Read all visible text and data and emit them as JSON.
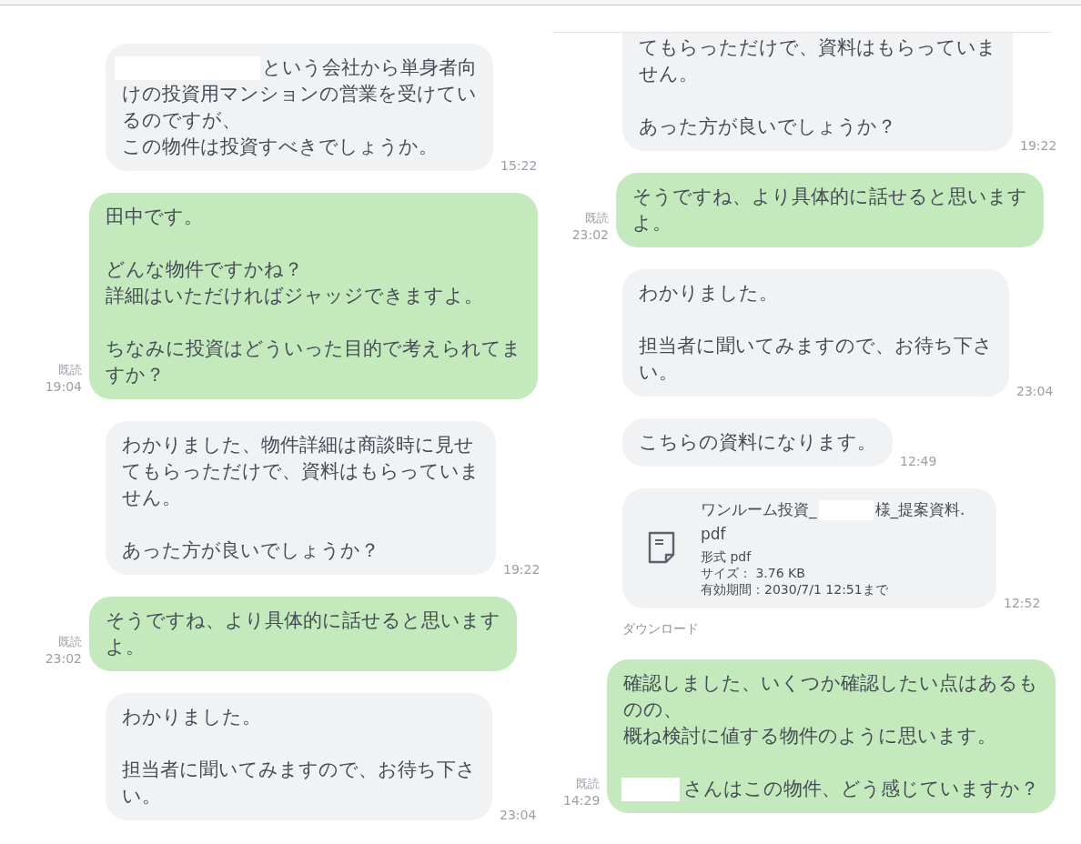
{
  "panels": [
    {
      "messages": [
        {
          "outgoing": false,
          "kind": "text",
          "paragraphs": [
            [
              [
                {
                  "kind": "redaction-long"
                },
                {
                  "kind": "text",
                  "text": "という会社から単身者向"
                }
              ],
              "けの投資用マンションの営業を受けてい",
              "るのですが、",
              "この物件は投資すべきでしょうか。"
            ]
          ],
          "time": "15:22"
        },
        {
          "outgoing": true,
          "kind": "text",
          "paragraphs": [
            [
              "田中です。"
            ],
            [
              "どんな物件ですかね？",
              "詳細はいただければジャッジできますよ。"
            ],
            [
              "ちなみに投資はどういった目的で考えられてま",
              "すか？"
            ]
          ],
          "time": "19:04",
          "read_label": "既読"
        },
        {
          "outgoing": false,
          "kind": "text",
          "paragraphs": [
            [
              "わかりました、物件詳細は商談時に見せ",
              "てもらっただけで、資料はもらっていま",
              "せん。"
            ],
            [
              "あった方が良いでしょうか？"
            ]
          ],
          "time": "19:22"
        },
        {
          "outgoing": true,
          "kind": "text",
          "paragraphs": [
            [
              "そうですね、より具体的に話せると思います",
              "よ。"
            ]
          ],
          "time": "23:02",
          "read_label": "既読"
        },
        {
          "outgoing": false,
          "kind": "text",
          "paragraphs": [
            [
              "わかりました。"
            ],
            [
              "担当者に聞いてみますので、お待ち下さ",
              "い。"
            ]
          ],
          "time": "23:04"
        }
      ]
    },
    {
      "messages": [
        {
          "outgoing": false,
          "kind": "text",
          "clipped_top": true,
          "paragraphs": [
            [
              "てもらっただけで、資料はもらっていま",
              "せん。"
            ],
            [
              "あった方が良いでしょうか？"
            ]
          ],
          "time": "19:22"
        },
        {
          "outgoing": true,
          "kind": "text",
          "paragraphs": [
            [
              "そうですね、より具体的に話せると思います",
              "よ。"
            ]
          ],
          "time": "23:02",
          "read_label": "既読"
        },
        {
          "outgoing": false,
          "kind": "text",
          "paragraphs": [
            [
              "わかりました。"
            ],
            [
              "担当者に聞いてみますので、お待ち下さ",
              "い。"
            ]
          ],
          "time": "23:04"
        },
        {
          "outgoing": false,
          "kind": "text",
          "paragraphs": [
            [
              "こちらの資料になります。"
            ]
          ],
          "time": "12:49"
        },
        {
          "outgoing": false,
          "kind": "file",
          "name_lines": [
            [
              {
                "kind": "text",
                "text": "ワンルーム投資_"
              },
              {
                "kind": "redaction-short"
              },
              {
                "kind": "text",
                "text": "様_提案資料."
              }
            ],
            "pdf"
          ],
          "details": [
            "形式 pdf",
            "サイズ： 3.76 KB",
            "有効期間：2030/7/1 12:51まで"
          ],
          "time": "12:52",
          "action": "ダウンロード"
        },
        {
          "outgoing": true,
          "kind": "text",
          "paragraphs": [
            [
              "確認しました、いくつか確認したい点はあるも",
              "のの、",
              "概ね検討に値する物件のように思います。"
            ],
            [
              [
                {
                  "kind": "redaction-short"
                },
                {
                  "kind": "text",
                  "text": "さんはこの物件、どう感じていますか？"
                }
              ]
            ]
          ],
          "time": "14:29",
          "read_label": "既読"
        }
      ]
    }
  ]
}
